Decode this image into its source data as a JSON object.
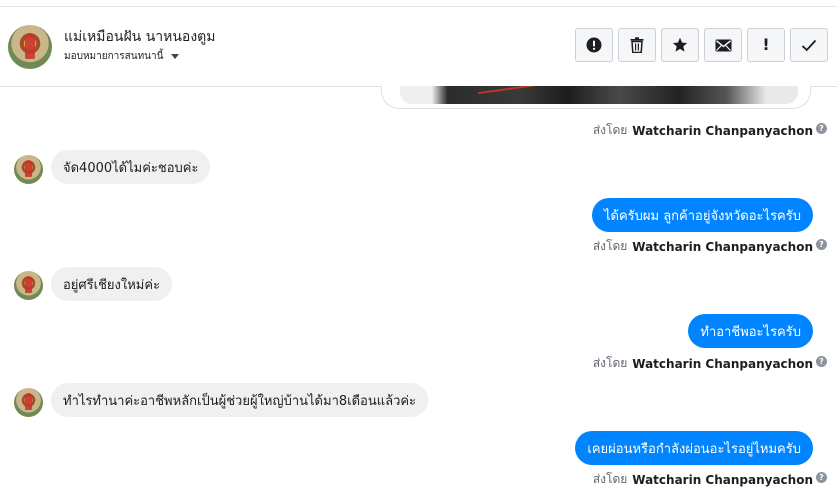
{
  "header": {
    "contact_name": "แม่เหมือนฝัน นาหนองตูม",
    "assign_label": "มอบหมายการสนทนานี้",
    "actions": [
      {
        "name": "mark-spam-button",
        "icon": "exclamation-circle-icon"
      },
      {
        "name": "delete-button",
        "icon": "trash-icon"
      },
      {
        "name": "star-button",
        "icon": "star-icon"
      },
      {
        "name": "unread-button",
        "icon": "envelope-icon"
      },
      {
        "name": "follow-up-button",
        "icon": "exclamation-icon",
        "glyph": "!"
      },
      {
        "name": "done-button",
        "icon": "checkmark-icon"
      }
    ]
  },
  "sent_by_prefix": "ส่งโดย",
  "agent_name": "Watcharin Chanpanyachon",
  "help_glyph": "?",
  "messages": [
    {
      "direction": "in",
      "text": "จัด4000ได้ไมค่ะชอบค่ะ"
    },
    {
      "direction": "out",
      "text": "ได้ครับผม ลูกค้าอยู่จังหวัดอะไรครับ"
    },
    {
      "direction": "in",
      "text": "อยู่ศรีเชียงใหม่ค่ะ"
    },
    {
      "direction": "out",
      "text": "ทำอาชีพอะไรครับ"
    },
    {
      "direction": "in",
      "text": "ทำไรทำนาค่ะอาชีพหลักเป็นผู้ช่วยผู้ใหญ่บ้านได้มา8เดือนแล้วค่ะ"
    },
    {
      "direction": "out",
      "text": "เคยผ่อนหรือกำลังผ่อนอะไรอยู่ไหมครับ"
    }
  ],
  "colors": {
    "outgoing_bubble": "#0084ff",
    "incoming_bubble": "#f0f0f0",
    "meta_text": "#606770"
  }
}
